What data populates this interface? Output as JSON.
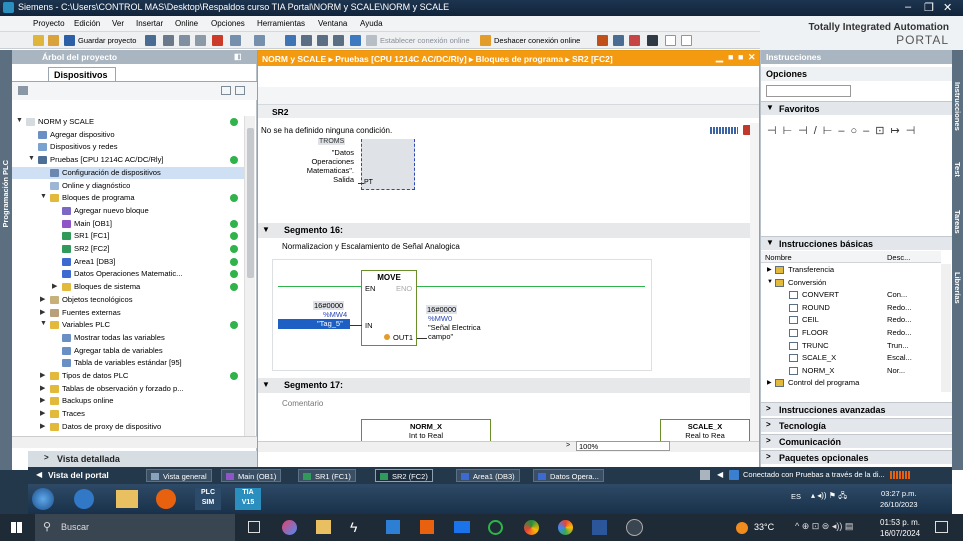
{
  "window": {
    "title": "Siemens - C:\\Users\\CONTROL MAS\\Desktop\\Respaldos curso TIA Portal\\NORM y SCALE\\NORM y SCALE"
  },
  "menu": [
    "Proyecto",
    "Edición",
    "Ver",
    "Insertar",
    "Online",
    "Opciones",
    "Herramientas",
    "Ventana",
    "Ayuda"
  ],
  "toolbar": {
    "save": "Guardar proyecto",
    "connect": "Establecer conexión online",
    "disconnect": "Deshacer conexión online"
  },
  "brand": {
    "line1": "Totally Integrated Automation",
    "line2": "PORTAL"
  },
  "left": {
    "vertical_tab": "Programación PLC",
    "header": "Árbol del proyecto",
    "tab": "Dispositivos",
    "tree": [
      {
        "label": "NORM y SCALE",
        "indent": 0,
        "arrow": "▼",
        "icon": "#d6dbe0",
        "dot": true
      },
      {
        "label": "Agregar dispositivo",
        "indent": 1,
        "icon": "#6a8fc4"
      },
      {
        "label": "Dispositivos y redes",
        "indent": 1,
        "icon": "#7aa2d0"
      },
      {
        "label": "Pruebas [CPU 1214C AC/DC/Rly]",
        "indent": 1,
        "arrow": "▼",
        "icon": "#4d6e96",
        "dot": true
      },
      {
        "label": "Configuración de dispositivos",
        "indent": 2,
        "icon": "#6c87b0",
        "selected": true
      },
      {
        "label": "Online y diagnóstico",
        "indent": 2,
        "icon": "#9db6d3"
      },
      {
        "label": "Bloques de programa",
        "indent": 2,
        "arrow": "▼",
        "icon": "#e2b93b",
        "dot": true
      },
      {
        "label": "Agregar nuevo bloque",
        "indent": 3,
        "icon": "#7c68c4"
      },
      {
        "label": "Main [OB1]",
        "indent": 3,
        "icon": "#9053c8",
        "dot": true
      },
      {
        "label": "SR1 [FC1]",
        "indent": 3,
        "icon": "#2f9a5a",
        "dot": true
      },
      {
        "label": "SR2 [FC2]",
        "indent": 3,
        "icon": "#2f9a5a",
        "dot": true
      },
      {
        "label": "Area1 [DB3]",
        "indent": 3,
        "icon": "#3d6ad1",
        "dot": true
      },
      {
        "label": "Datos Operaciones Matematic...",
        "indent": 3,
        "icon": "#3d6ad1",
        "dot": true
      },
      {
        "label": "Bloques de sistema",
        "indent": 3,
        "arrow": "▶",
        "icon": "#e2b93b",
        "dot": true
      },
      {
        "label": "Objetos tecnológicos",
        "indent": 2,
        "arrow": "▶",
        "icon": "#c7b07a"
      },
      {
        "label": "Fuentes externas",
        "indent": 2,
        "arrow": "▶",
        "icon": "#b8a07a"
      },
      {
        "label": "Variables PLC",
        "indent": 2,
        "arrow": "▼",
        "icon": "#e2b93b",
        "dot": true
      },
      {
        "label": "Mostrar todas las variables",
        "indent": 3,
        "icon": "#6a8fc4"
      },
      {
        "label": "Agregar tabla de variables",
        "indent": 3,
        "icon": "#6a8fc4"
      },
      {
        "label": "Tabla de variables estándar [95]",
        "indent": 3,
        "icon": "#6a8fc4"
      },
      {
        "label": "Tipos de datos PLC",
        "indent": 2,
        "arrow": "▶",
        "icon": "#e2b93b",
        "dot": true
      },
      {
        "label": "Tablas de observación y forzado p...",
        "indent": 2,
        "arrow": "▶",
        "icon": "#e2b93b"
      },
      {
        "label": "Backups online",
        "indent": 2,
        "arrow": "▶",
        "icon": "#e2b93b"
      },
      {
        "label": "Traces",
        "indent": 2,
        "arrow": "▶",
        "icon": "#e2b93b"
      },
      {
        "label": "Datos de proxy de dispositivo",
        "indent": 2,
        "arrow": "▶",
        "icon": "#e2b93b"
      }
    ],
    "detail": "Vista detallada"
  },
  "editor": {
    "breadcrumb": "NORM y SCALE  ▸  Pruebas [CPU 1214C AC/DC/Rly]  ▸  Bloques de programa  ▸  SR2 [FC2]",
    "block_name": "SR2",
    "no_condition": "No se ha definido ninguna condición.",
    "prev_block": {
      "tag": "TROMS",
      "text1": "\"Datos",
      "text2": "Operaciones",
      "text3": "Matematicas\".",
      "text4": "Salida",
      "pin": "PT"
    },
    "seg16": {
      "title": "Segmento 16:",
      "comment": "Normalizacion y Escalamiento de Señal Analogica",
      "box_title": "MOVE",
      "en": "EN",
      "eno": "ENO",
      "in": "IN",
      "out": "OUT1",
      "in_value": "16#0000",
      "in_addr": "%MW4",
      "in_tag": "\"Tag_5\"",
      "out_value": "16#0000",
      "out_addr": "%MW0",
      "out_tag1": "\"Señal Electrica",
      "out_tag2": "campo\""
    },
    "seg17": {
      "title": "Segmento 17:",
      "comment": "Comentario",
      "box1_title": "NORM_X",
      "box1_sub": "Int to Real",
      "box2_title": "SCALE_X",
      "box2_sub": "Real to Rea"
    },
    "zoom": "100%"
  },
  "right": {
    "header": "Instrucciones",
    "options": "Opciones",
    "favorites": "Favoritos",
    "basic": "Instrucciones básicas",
    "col_name": "Nombre",
    "col_desc": "Desc...",
    "items": [
      {
        "name": "Transferencia",
        "desc": "",
        "indent": 0,
        "arrow": "▶"
      },
      {
        "name": "Conversión",
        "desc": "",
        "indent": 0,
        "arrow": "▼"
      },
      {
        "name": "CONVERT",
        "desc": "Con...",
        "indent": 1
      },
      {
        "name": "ROUND",
        "desc": "Redo...",
        "indent": 1
      },
      {
        "name": "CEIL",
        "desc": "Redo...",
        "indent": 1
      },
      {
        "name": "FLOOR",
        "desc": "Redo...",
        "indent": 1
      },
      {
        "name": "TRUNC",
        "desc": "Trun...",
        "indent": 1
      },
      {
        "name": "SCALE_X",
        "desc": "Escal...",
        "indent": 1
      },
      {
        "name": "NORM_X",
        "desc": "Nor...",
        "indent": 1
      },
      {
        "name": "Control del programa",
        "desc": "",
        "indent": 0,
        "arrow": "▶"
      }
    ],
    "advanced": "Instrucciones avanzadas",
    "technology": "Tecnología",
    "communication": "Comunicación",
    "packages": "Paquetes opcionales",
    "vtabs": [
      "Instrucciones",
      "Test",
      "Tareas",
      "Librerías"
    ]
  },
  "portal": {
    "back": "Vista del portal",
    "tabs": [
      "Vista general",
      "Main (OB1)",
      "SR1 (FC1)",
      "SR2 (FC2)",
      "Area1 (DB3)",
      "Datos Opera..."
    ],
    "status": "Conectado con Pruebas a través de la di..."
  },
  "win7": {
    "lang": "ES",
    "time": "03:27 p.m.",
    "date": "26/10/2023",
    "plc_label": "PLC\nSIM",
    "tia_label": "TIA\nV15"
  },
  "win10": {
    "search": "Buscar",
    "temp": "33°C",
    "time": "01:53 p. m.",
    "date": "16/07/2024"
  }
}
